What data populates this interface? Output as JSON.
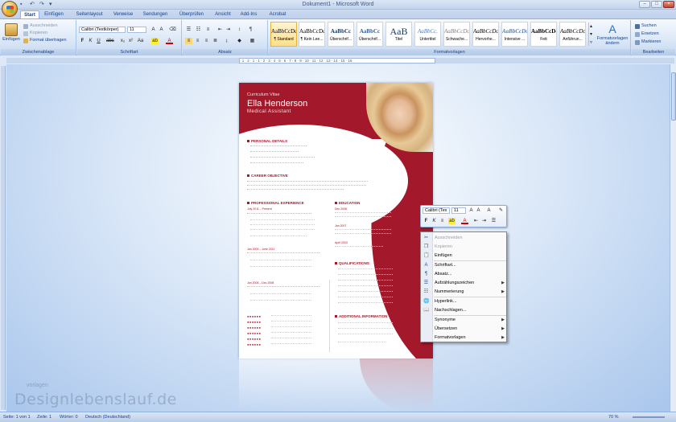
{
  "window": {
    "title": "Dokument1 - Microsoft Word"
  },
  "tabs": [
    "Start",
    "Einfügen",
    "Seitenlayout",
    "Verweise",
    "Sendungen",
    "Überprüfen",
    "Ansicht",
    "Add-Ins",
    "Acrobat"
  ],
  "ribbon": {
    "clipboard": {
      "paste": "Einfügen",
      "cut": "Ausschneiden",
      "copy": "Kopieren",
      "format_painter": "Format übertragen",
      "label": "Zwischenablage"
    },
    "font": {
      "name": "Calibri (Textkörper)",
      "size": "11",
      "label": "Schriftart"
    },
    "paragraph": {
      "label": "Absatz"
    },
    "styles": {
      "label": "Formatvorlagen",
      "items": [
        {
          "sample": "AaBbCcDc",
          "name": "¶ Standard"
        },
        {
          "sample": "AaBbCcDc",
          "name": "¶ Kein Lee..."
        },
        {
          "sample": "AaBbCc",
          "name": "Überschrif..."
        },
        {
          "sample": "AaBbCc",
          "name": "Überschrif..."
        },
        {
          "sample": "AaB",
          "name": "Titel"
        },
        {
          "sample": "AaBbCc.",
          "name": "Untertitel"
        },
        {
          "sample": "AaBbCcDc",
          "name": "Schwache..."
        },
        {
          "sample": "AaBbCcDc",
          "name": "Hervorhe..."
        },
        {
          "sample": "AaBbCcDc",
          "name": "Intensive ..."
        },
        {
          "sample": "AaBbCcDc",
          "name": "Fett"
        },
        {
          "sample": "AaBbCcDc",
          "name": "Anführun..."
        }
      ],
      "change": "Formatvorlagen ändern"
    },
    "editing": {
      "find": "Suchen",
      "replace": "Ersetzen",
      "select": "Markieren",
      "label": "Bearbeiten"
    }
  },
  "ruler_text": "· 1 · 2 · 1 · 1 · 2 · 3 · 4 · 5 · 6 · 7 · 8 · 9 · 10 · 11 · 12 · 13 · 14 · 15 · 16",
  "cv": {
    "label": "Curriculum Vitae",
    "name": "Ella Henderson",
    "role": "Medical Assistant",
    "sections": {
      "personal": "PERSONAL DETAILS",
      "career": "CAREER OBJECTIVE",
      "experience": "PROFESSIONAL EXPERIENCE",
      "education": "EDUCATION",
      "qualifications": "QUALIFICATIONS",
      "additional": "ADDITIONAL INFORMATION"
    },
    "exp_dates": [
      "July 2011 – Present",
      "Jan 2009 – June 2011",
      "Jan 2008 – Dec 2008"
    ],
    "edu_dates": [
      "Dec 2008",
      "Jan 2007",
      "April 2003"
    ]
  },
  "mini_toolbar": {
    "font": "Calibri (Tex",
    "size": "11"
  },
  "context_menu": {
    "items": [
      {
        "label": "Ausschneiden",
        "disabled": true,
        "icon": "scissors-icon",
        "submenu": false
      },
      {
        "label": "Kopieren",
        "disabled": true,
        "icon": "copy-icon",
        "submenu": false
      },
      {
        "label": "Einfügen",
        "disabled": false,
        "icon": "paste-icon",
        "submenu": false
      },
      {
        "label": "Schriftart...",
        "disabled": false,
        "icon": "font-icon",
        "submenu": false
      },
      {
        "label": "Absatz...",
        "disabled": false,
        "icon": "paragraph-icon",
        "submenu": false
      },
      {
        "label": "Aufzählungszeichen",
        "disabled": false,
        "icon": "bullets-icon",
        "submenu": true
      },
      {
        "label": "Nummerierung",
        "disabled": false,
        "icon": "numbering-icon",
        "submenu": true
      },
      {
        "label": "Hyperlink...",
        "disabled": false,
        "icon": "hyperlink-icon",
        "submenu": false
      },
      {
        "label": "Nachschlagen...",
        "disabled": false,
        "icon": "lookup-icon",
        "submenu": false
      },
      {
        "label": "Synonyme",
        "disabled": false,
        "icon": "",
        "submenu": true
      },
      {
        "label": "Übersetzen",
        "disabled": false,
        "icon": "",
        "submenu": true
      },
      {
        "label": "Formatvorlagen",
        "disabled": false,
        "icon": "",
        "submenu": true
      }
    ]
  },
  "status": {
    "page": "Seite: 1 von 1",
    "line": "Zeile: 1",
    "words": "Wörter: 0",
    "language": "Deutsch (Deutschland)",
    "zoom": "70 %"
  },
  "watermark": {
    "small": "vorlagen",
    "text": "Designlebenslauf.de"
  },
  "colors": {
    "accent": "#a3182a",
    "ribbon": "#dbe7f7"
  }
}
